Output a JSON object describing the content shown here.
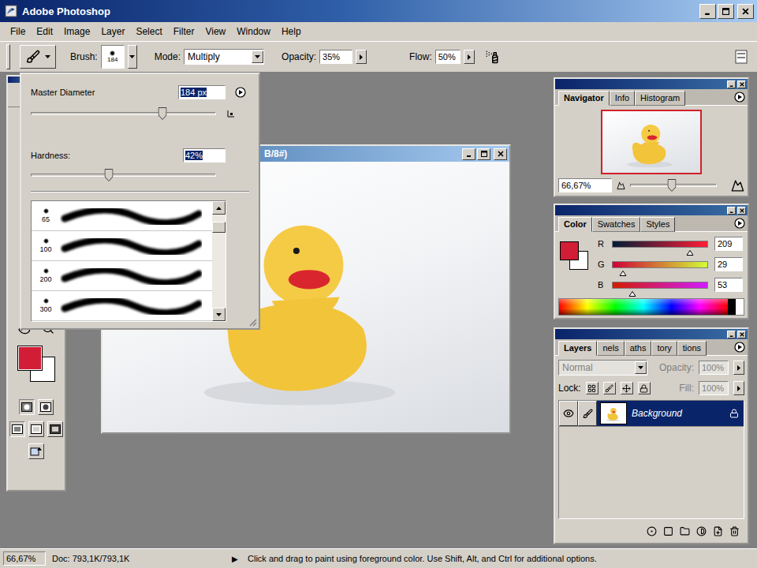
{
  "window": {
    "title": "Adobe Photoshop"
  },
  "menu": [
    "File",
    "Edit",
    "Image",
    "Layer",
    "Select",
    "Filter",
    "View",
    "Window",
    "Help"
  ],
  "options_bar": {
    "brush_label": "Brush:",
    "brush_size": "184",
    "mode_label": "Mode:",
    "mode": "Multiply",
    "opacity_label": "Opacity:",
    "opacity": "35%",
    "flow_label": "Flow:",
    "flow": "50%"
  },
  "brush_picker": {
    "diameter_label": "Master Diameter",
    "diameter": "184 px",
    "diameter_level": 0.71,
    "hardness_label": "Hardness:",
    "hardness": "42%",
    "hardness_level": 0.42,
    "presets": [
      {
        "size": "65"
      },
      {
        "size": "100"
      },
      {
        "size": "200"
      },
      {
        "size": "300"
      }
    ],
    "scroll_level": 0.08
  },
  "toolbox": {
    "foreground": "#d11d35",
    "background": "#ffffff"
  },
  "document": {
    "title": "B/8#)"
  },
  "navigator": {
    "tabs": [
      {
        "label": "Navigator",
        "selected": true
      },
      {
        "label": "Info",
        "selected": false
      },
      {
        "label": "Histogram",
        "selected": false
      }
    ],
    "zoom": "66,67%",
    "zoom_level": 0.48
  },
  "color": {
    "tabs": [
      {
        "label": "Color",
        "selected": true
      },
      {
        "label": "Swatches",
        "selected": false
      },
      {
        "label": "Styles",
        "selected": false
      }
    ],
    "foreground": "#d11d35",
    "background": "#ffffff",
    "channels": [
      {
        "name": "R",
        "value": "209",
        "level": 0.82
      },
      {
        "name": "G",
        "value": "29",
        "level": 0.11
      },
      {
        "name": "B",
        "value": "53",
        "level": 0.21
      }
    ]
  },
  "layers": {
    "tabs": [
      {
        "label": "Layers",
        "selected": true
      },
      {
        "label": "nels",
        "selected": false
      },
      {
        "label": "aths",
        "selected": false
      },
      {
        "label": "tory",
        "selected": false
      },
      {
        "label": "tions",
        "selected": false
      }
    ],
    "blend": "Normal",
    "opacity_label": "Opacity:",
    "opacity": "100%",
    "lock_label": "Lock:",
    "fill_label": "Fill:",
    "fill": "100%",
    "disabled": true,
    "items": [
      {
        "name": "Background",
        "selected": true,
        "visible": true,
        "locked": true
      }
    ]
  },
  "status_bar": {
    "zoom": "66,67%",
    "doc": "Doc: 793,1K/793,1K",
    "arrow": "▶",
    "hint": "Click and drag to paint using foreground color. Use Shift, Alt, and Ctrl for additional options."
  }
}
